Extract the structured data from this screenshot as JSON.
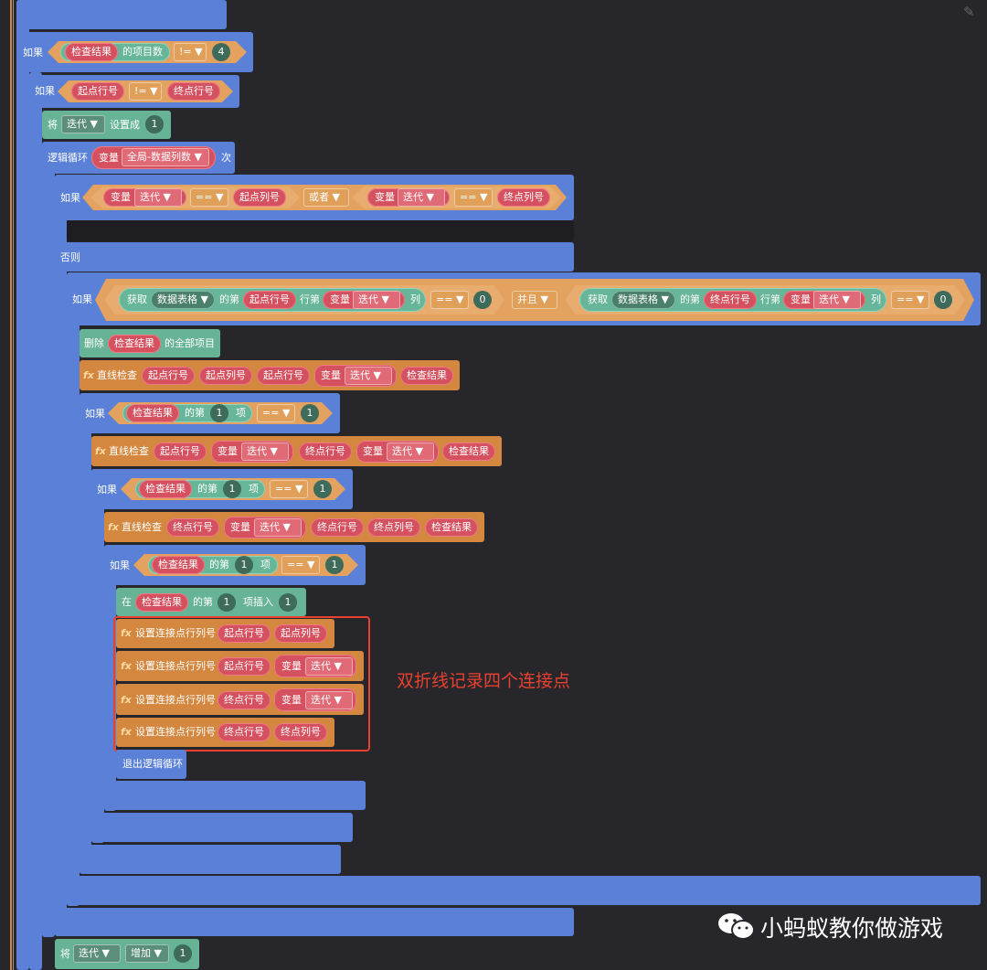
{
  "labels": {
    "if": "如果",
    "else": "否则",
    "set_prefix": "将",
    "set_to": "设置成",
    "loop": "逻辑循环",
    "times": "次",
    "var": "变量",
    "or": "或者",
    "and": "并且",
    "get": "获取",
    "of": "的第",
    "row_of": "行第",
    "col": "列",
    "item_count": "的项目数",
    "item": "项",
    "delete_all": "删除",
    "all_items": "的全部项目",
    "insert_at": "在",
    "insert_item": "项插入",
    "break_loop": "退出逻辑循环",
    "increase": "增加",
    "fx": "fx"
  },
  "values": {
    "check_result": "检查结果",
    "start_row": "起点行号",
    "end_row": "终点行号",
    "start_col": "起点列号",
    "end_col": "终点列号",
    "iter": "迭代",
    "global_cols": "全局-数据列数",
    "data_table": "数据表格",
    "ne": "!=",
    "eq": "==",
    "n0": "0",
    "n1": "1",
    "n4": "4",
    "dd": "▼"
  },
  "functions": {
    "line_check": "直线检查",
    "set_point": "设置连接点行列号"
  },
  "annotation": "双折线记录四个连接点",
  "watermark": "小蚂蚁教你做游戏",
  "colors": {
    "background": "#26262b",
    "control": "#5b80d7",
    "function": "#d4873f",
    "list": "#66b395",
    "variable": "#d5515f",
    "annotation": "#e8412f"
  }
}
